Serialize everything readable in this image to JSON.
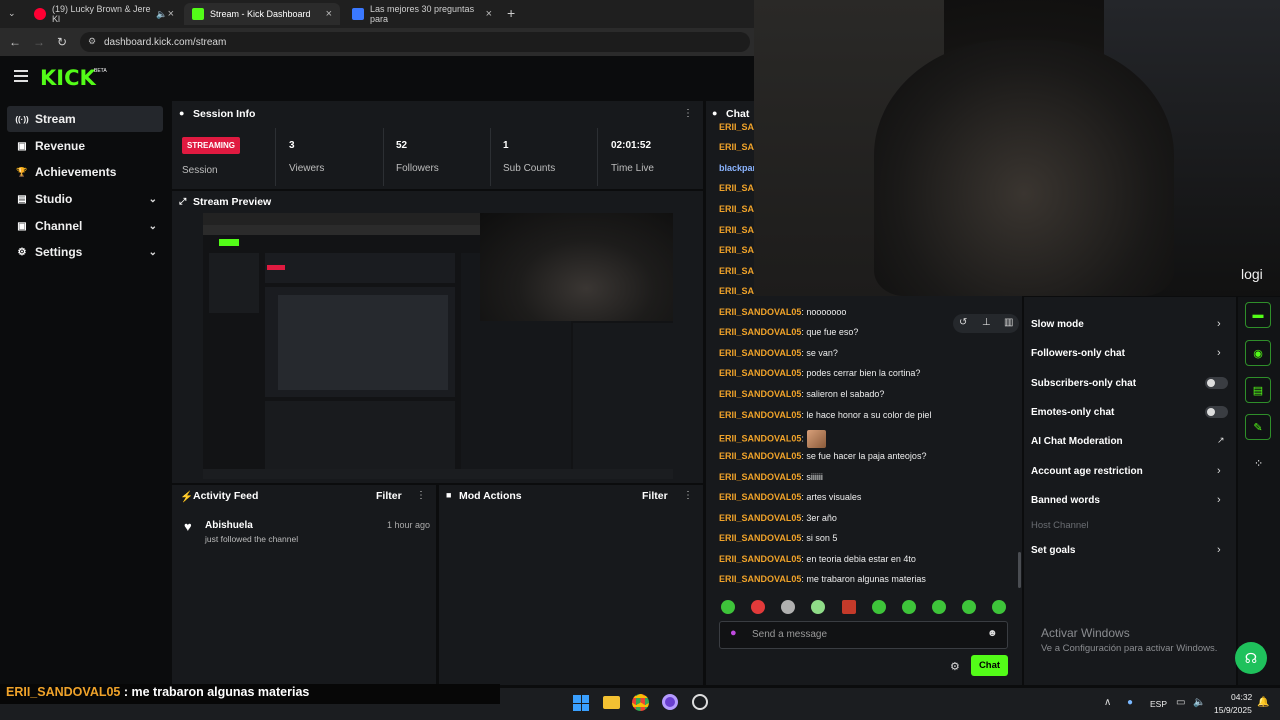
{
  "browser": {
    "tabs": [
      {
        "label": "(19) Lucky Brown & Jere Kl",
        "close": "×",
        "color": "#ff0033"
      },
      {
        "label": "Stream - Kick Dashboard",
        "close": "×",
        "color": "#53fc18"
      },
      {
        "label": "Las mejores 30 preguntas para",
        "close": "×",
        "color": "#3a78ff"
      }
    ],
    "new_tab": "+",
    "url": "dashboard.kick.com/stream"
  },
  "logo": {
    "text": "KICK",
    "badge": "BETA"
  },
  "sidebar": {
    "items": [
      {
        "label": "Stream",
        "icon": "((·))",
        "active": true
      },
      {
        "label": "Revenue",
        "icon": "▣"
      },
      {
        "label": "Achievements",
        "icon": "🏆"
      },
      {
        "label": "Studio",
        "icon": "▤",
        "chevron": "⌄"
      },
      {
        "label": "Channel",
        "icon": "▣",
        "chevron": "⌄"
      },
      {
        "label": "Settings",
        "icon": "⚙",
        "chevron": "⌄"
      }
    ]
  },
  "session": {
    "title": "Session Info",
    "status_badge": "STREAMING",
    "status_label": "Session",
    "stats": [
      {
        "value": "3",
        "label": "Viewers"
      },
      {
        "value": "52",
        "label": "Followers"
      },
      {
        "value": "1",
        "label": "Sub Counts"
      },
      {
        "value": "02:01:52",
        "label": "Time Live"
      }
    ]
  },
  "preview": {
    "title": "Stream Preview"
  },
  "activity": {
    "title": "Activity Feed",
    "filter": "Filter",
    "items": [
      {
        "name": "Abishuela",
        "time": "1 hour ago",
        "action": "just followed the channel"
      }
    ]
  },
  "mod_actions": {
    "title": "Mod Actions",
    "filter": "Filter"
  },
  "chat": {
    "title": "Chat",
    "hidden_users": [
      "ERII_SAN",
      "blackpar",
      "ERII_SAN",
      "ERII_SAN",
      "ERII_SAN",
      "ERII_SAN",
      "ERII_SAN",
      "ERII_SAN"
    ],
    "messages": [
      {
        "user": "ERII_SANDOVAL05",
        "text": ": nooooooo"
      },
      {
        "user": "ERII_SANDOVAL05",
        "text": ": que fue eso?"
      },
      {
        "user": "ERII_SANDOVAL05",
        "text": ": se van?"
      },
      {
        "user": "ERII_SANDOVAL05",
        "text": ": podes cerrar bien la cortina?"
      },
      {
        "user": "ERII_SANDOVAL05",
        "text": ": salieron el sabado?"
      },
      {
        "user": "ERII_SANDOVAL05",
        "text": ": le hace honor a su color de piel"
      },
      {
        "user": "ERII_SANDOVAL05",
        "text": ":"
      },
      {
        "user": "ERII_SANDOVAL05",
        "text": ": se fue hacer la paja anteojos?"
      },
      {
        "user": "ERII_SANDOVAL05",
        "text": ": siiiiii"
      },
      {
        "user": "ERII_SANDOVAL05",
        "text": ": artes visuales"
      },
      {
        "user": "ERII_SANDOVAL05",
        "text": ": 3er año"
      },
      {
        "user": "ERII_SANDOVAL05",
        "text": ": si son 5"
      },
      {
        "user": "ERII_SANDOVAL05",
        "text": ": en teoria debia estar en 4to"
      },
      {
        "user": "ERII_SANDOVAL05",
        "text": ": me trabaron algunas materias"
      }
    ],
    "input_placeholder": "Send a message",
    "send_label": "Chat"
  },
  "mod_menu": {
    "items": [
      {
        "label": "Slow mode",
        "control": "chevron"
      },
      {
        "label": "Followers-only chat",
        "control": "chevron"
      },
      {
        "label": "Subscribers-only chat",
        "control": "toggle"
      },
      {
        "label": "Emotes-only chat",
        "control": "toggle"
      },
      {
        "label": "AI Chat Moderation",
        "control": "external"
      },
      {
        "label": "Account age restriction",
        "control": "chevron"
      },
      {
        "label": "Banned words",
        "control": "chevron"
      },
      {
        "label": "Host Channel",
        "control": "disabled"
      },
      {
        "label": "Set goals",
        "control": "chevron"
      }
    ]
  },
  "webcam": {
    "watermark": "logi"
  },
  "windows": {
    "activate_title": "Activar Windows",
    "activate_sub": "Ve a Configuración para activar Windows."
  },
  "overlay_subtitle": {
    "user": "ERII_SANDOVAL05",
    "text": " : me trabaron algunas materias"
  },
  "taskbar": {
    "lang": "ESP",
    "time": "04:32",
    "date": "15/9/2025"
  },
  "colors": {
    "accent": "#53fc18",
    "live": "#e01a40",
    "username": "#f0a32a"
  }
}
